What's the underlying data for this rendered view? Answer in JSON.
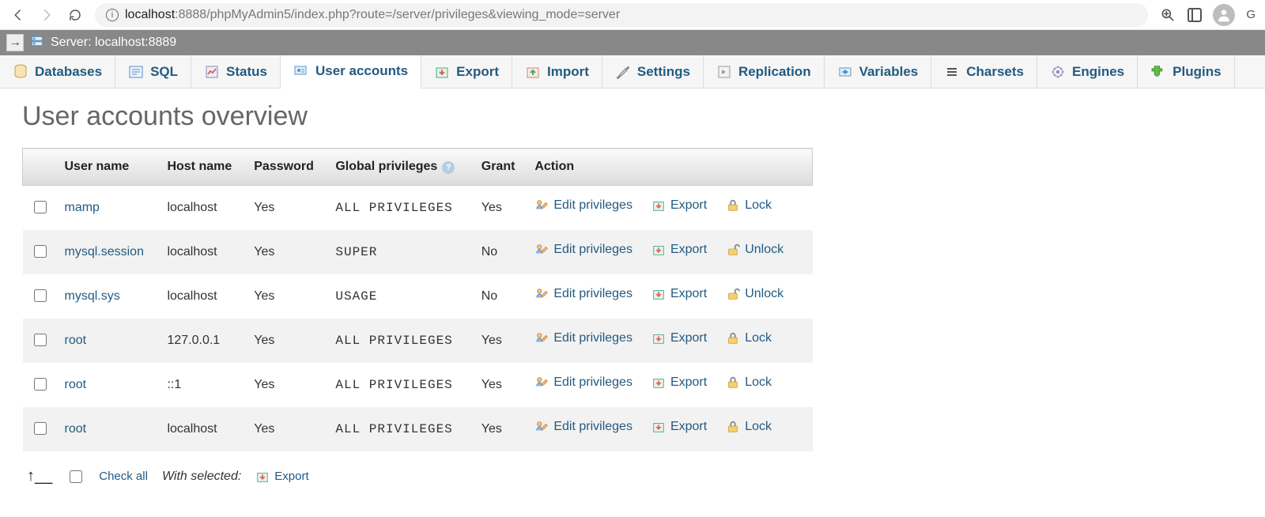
{
  "browser": {
    "url_host": "localhost",
    "url_port": ":8888",
    "url_path": "/phpMyAdmin5/index.php?route=/server/privileges&viewing_mode=server",
    "guest_label": "G"
  },
  "server": {
    "label": "Server: localhost:8889"
  },
  "tabs": [
    {
      "label": "Databases",
      "icon": "databases"
    },
    {
      "label": "SQL",
      "icon": "sql"
    },
    {
      "label": "Status",
      "icon": "status"
    },
    {
      "label": "User accounts",
      "icon": "user-accounts",
      "active": true
    },
    {
      "label": "Export",
      "icon": "export"
    },
    {
      "label": "Import",
      "icon": "import"
    },
    {
      "label": "Settings",
      "icon": "settings"
    },
    {
      "label": "Replication",
      "icon": "replication"
    },
    {
      "label": "Variables",
      "icon": "variables"
    },
    {
      "label": "Charsets",
      "icon": "charsets"
    },
    {
      "label": "Engines",
      "icon": "engines"
    },
    {
      "label": "Plugins",
      "icon": "plugins"
    }
  ],
  "page": {
    "title": "User accounts overview"
  },
  "columns": {
    "check": "",
    "user": "User name",
    "host": "Host name",
    "password": "Password",
    "privileges": "Global privileges",
    "grant": "Grant",
    "action": "Action"
  },
  "action_labels": {
    "edit": "Edit privileges",
    "export": "Export",
    "lock": "Lock",
    "unlock": "Unlock"
  },
  "rows": [
    {
      "user": "mamp",
      "host": "localhost",
      "password": "Yes",
      "privileges": "ALL PRIVILEGES",
      "grant": "Yes",
      "lock_action": "Lock"
    },
    {
      "user": "mysql.session",
      "host": "localhost",
      "password": "Yes",
      "privileges": "SUPER",
      "grant": "No",
      "lock_action": "Unlock"
    },
    {
      "user": "mysql.sys",
      "host": "localhost",
      "password": "Yes",
      "privileges": "USAGE",
      "grant": "No",
      "lock_action": "Unlock"
    },
    {
      "user": "root",
      "host": "127.0.0.1",
      "password": "Yes",
      "privileges": "ALL PRIVILEGES",
      "grant": "Yes",
      "lock_action": "Lock"
    },
    {
      "user": "root",
      "host": "::1",
      "password": "Yes",
      "privileges": "ALL PRIVILEGES",
      "grant": "Yes",
      "lock_action": "Lock"
    },
    {
      "user": "root",
      "host": "localhost",
      "password": "Yes",
      "privileges": "ALL PRIVILEGES",
      "grant": "Yes",
      "lock_action": "Lock"
    }
  ],
  "bulk": {
    "check_all": "Check all",
    "with_selected": "With selected:",
    "export": "Export"
  }
}
